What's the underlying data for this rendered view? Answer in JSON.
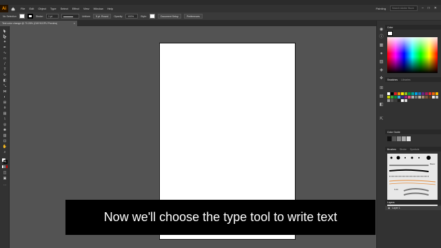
{
  "menubar": {
    "logo": "Ai",
    "items": [
      "File",
      "Edit",
      "Object",
      "Type",
      "Select",
      "Effect",
      "View",
      "Window",
      "Help"
    ],
    "workspace": "Painting",
    "search_placeholder": "Search Adobe Stock",
    "window_buttons": [
      "–",
      "□",
      "✕"
    ]
  },
  "controlbar": {
    "selection": "No Selection",
    "stroke_label": "Stroke:",
    "stroke_value": "1 pt",
    "profile": "Uniform",
    "brush": "5 pt. Round",
    "opacity_label": "Opacity:",
    "opacity_value": "100%",
    "style_label": "Style:",
    "document_setup": "Document Setup",
    "preferences": "Preferences"
  },
  "document": {
    "tab_title": "Text color change @ 70.28% (CMYK/GPU Preview)",
    "close": "×"
  },
  "panels": {
    "color_tab": "Color",
    "swatches_tab": "Swatches",
    "libraries_tab": "Libraries",
    "color_guide_tab": "Color Guide",
    "brushes_tab": "Brushes",
    "stroke_tab": "Stroke",
    "symbols_tab": "Symbols",
    "basic_label": "Basic",
    "brush_size": "6.00",
    "layers_tab": "Layers",
    "layer_name": "Layer 1"
  },
  "caption": "Now we'll choose the type tool to write text"
}
